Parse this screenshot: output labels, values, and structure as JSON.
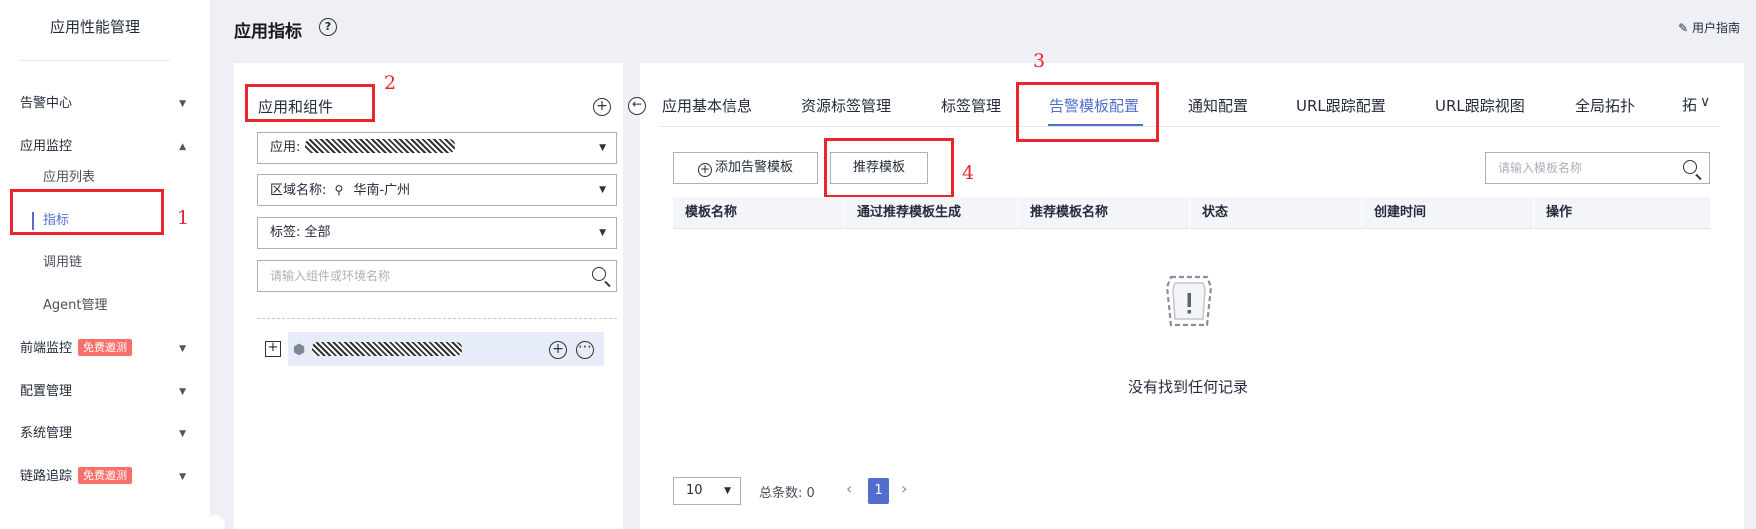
{
  "sidebar": {
    "title": "应用性能管理",
    "items": [
      {
        "label": "告警中心"
      },
      {
        "label": "应用监控"
      },
      {
        "label": "前端监控",
        "badge": "免费邀测"
      },
      {
        "label": "配置管理"
      },
      {
        "label": "系统管理"
      },
      {
        "label": "链路追踪",
        "badge": "免费邀测"
      }
    ],
    "sub_items": [
      {
        "label": "应用列表"
      },
      {
        "label": "指标"
      },
      {
        "label": "调用链"
      },
      {
        "label": "Agent管理"
      }
    ]
  },
  "header": {
    "title": "应用指标",
    "help_icon": "?",
    "guide": "用户指南"
  },
  "left_panel": {
    "heading": "应用和组件",
    "app_label": "应用:",
    "region_label": "区域名称:",
    "region_value": "华南-广州",
    "tag_label": "标签:",
    "tag_value": "全部",
    "search_placeholder": "请输入组件或环境名称"
  },
  "tabs": [
    {
      "label": "应用基本信息"
    },
    {
      "label": "资源标签管理"
    },
    {
      "label": "标签管理"
    },
    {
      "label": "告警模板配置"
    },
    {
      "label": "通知配置"
    },
    {
      "label": "URL跟踪配置"
    },
    {
      "label": "URL跟踪视图"
    },
    {
      "label": "全局拓扑"
    },
    {
      "label": "拓"
    }
  ],
  "toolbar": {
    "add_label": "添加告警模板",
    "recommend_label": "推荐模板",
    "search_placeholder": "请输入模板名称"
  },
  "table": {
    "columns": [
      "模板名称",
      "通过推荐模板生成",
      "推荐模板名称",
      "状态",
      "创建时间",
      "操作"
    ],
    "rows": [],
    "empty_text": "没有找到任何记录"
  },
  "pagination": {
    "page_size": "10",
    "total_label": "总条数:",
    "total": "0",
    "current_page": "1"
  },
  "annotations": [
    "1",
    "2",
    "3",
    "4"
  ],
  "colors": {
    "accent": "#526ecc",
    "annotation_red": "#e8262c",
    "badge": "#f66f6a"
  }
}
